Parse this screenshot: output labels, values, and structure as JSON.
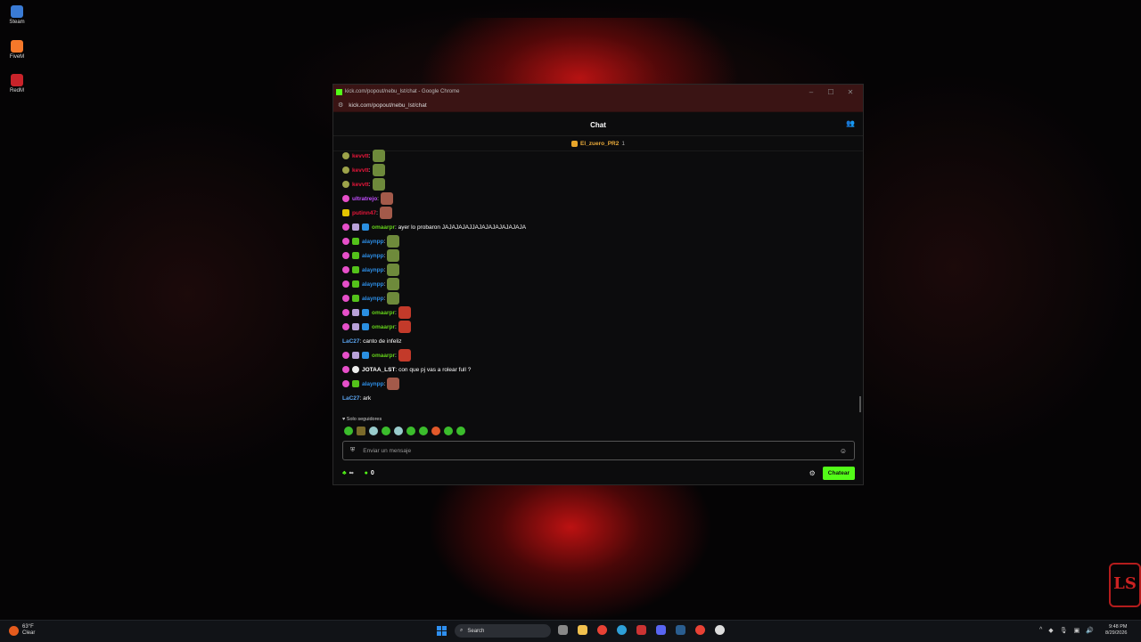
{
  "desktop": {
    "icons": [
      {
        "label": "Steam",
        "color": "#3a7bd5"
      },
      {
        "label": "FiveM",
        "color": "#f5782a"
      },
      {
        "label": "RedM",
        "color": "#c9232a"
      }
    ]
  },
  "window": {
    "title": "kick.com/popout/nebu_lst/chat - Google Chrome",
    "url": "kick.com/popout/nebu_lst/chat",
    "controls": {
      "minimize": "–",
      "maximize": "☐",
      "close": "✕"
    }
  },
  "chat": {
    "header_title": "Chat",
    "pinned_user": "El_zuero_PR2",
    "pinned_count": "1",
    "messages": [
      {
        "user": "kevvtt",
        "color": "#e7163a",
        "text": ":",
        "badges": [
          "olive"
        ],
        "emote": "frog"
      },
      {
        "user": "kevvtt",
        "color": "#e7163a",
        "text": ":",
        "badges": [
          "olive"
        ],
        "emote": "frog"
      },
      {
        "user": "kevvtt",
        "color": "#e7163a",
        "text": ":",
        "badges": [
          "olive"
        ],
        "emote": "frog"
      },
      {
        "user": "ultratrejo",
        "color": "#c34dff",
        "text": ":",
        "badges": [
          "pink"
        ],
        "emote": "face"
      },
      {
        "user": "putinn47",
        "color": "#e7163a",
        "text": ":",
        "badges": [
          "yellow"
        ],
        "emote": "face"
      },
      {
        "user": "omaarpr",
        "color": "#64d21a",
        "text": ": ayer lo probaron JAJAJAJAJJAJAJAJAJAJAJAJA",
        "badges": [
          "pink",
          "sub",
          "blue"
        ],
        "emote": ""
      },
      {
        "user": "alaynpp",
        "color": "#2d8fe8",
        "text": ":",
        "badges": [
          "pink",
          "green"
        ],
        "emote": "frog"
      },
      {
        "user": "alaynpp",
        "color": "#2d8fe8",
        "text": ":",
        "badges": [
          "pink",
          "green"
        ],
        "emote": "frog"
      },
      {
        "user": "alaynpp",
        "color": "#2d8fe8",
        "text": ":",
        "badges": [
          "pink",
          "green"
        ],
        "emote": "frog"
      },
      {
        "user": "alaynpp",
        "color": "#2d8fe8",
        "text": ":",
        "badges": [
          "pink",
          "green"
        ],
        "emote": "frog"
      },
      {
        "user": "alaynpp",
        "color": "#2d8fe8",
        "text": ":",
        "badges": [
          "pink",
          "green"
        ],
        "emote": "frog"
      },
      {
        "user": "omaarpr",
        "color": "#64d21a",
        "text": ":",
        "badges": [
          "pink",
          "sub",
          "blue"
        ],
        "emote": "red"
      },
      {
        "user": "omaarpr",
        "color": "#64d21a",
        "text": ":",
        "badges": [
          "pink",
          "sub",
          "blue"
        ],
        "emote": "red"
      },
      {
        "user": "LaC27",
        "color": "#5aa4ef",
        "text": ": canto de infeliz",
        "badges": [],
        "emote": ""
      },
      {
        "user": "omaarpr",
        "color": "#64d21a",
        "text": ":",
        "badges": [
          "pink",
          "sub",
          "blue"
        ],
        "emote": "red"
      },
      {
        "user": "JOTAA_LST",
        "color": "#ffffff",
        "text": ": con que pj vas a rolear full ?",
        "badges": [
          "pink",
          "white"
        ],
        "emote": ""
      },
      {
        "user": "alaynpp",
        "color": "#2d8fe8",
        "text": ":",
        "badges": [
          "pink",
          "green"
        ],
        "emote": "face"
      },
      {
        "user": "LaC27",
        "color": "#5aa4ef",
        "text": ": ark",
        "badges": [],
        "emote": ""
      }
    ],
    "followers_only": "Solo seguidores",
    "input_placeholder": "Enviar un mensaje",
    "stats": {
      "infinite": "∞",
      "count": "0"
    },
    "send_button": "Chatear"
  },
  "taskbar": {
    "weather_temp": "63°F",
    "weather_desc": "Clear",
    "search_placeholder": "Search",
    "time": "9:48 PM",
    "date": "8/29/2026"
  }
}
